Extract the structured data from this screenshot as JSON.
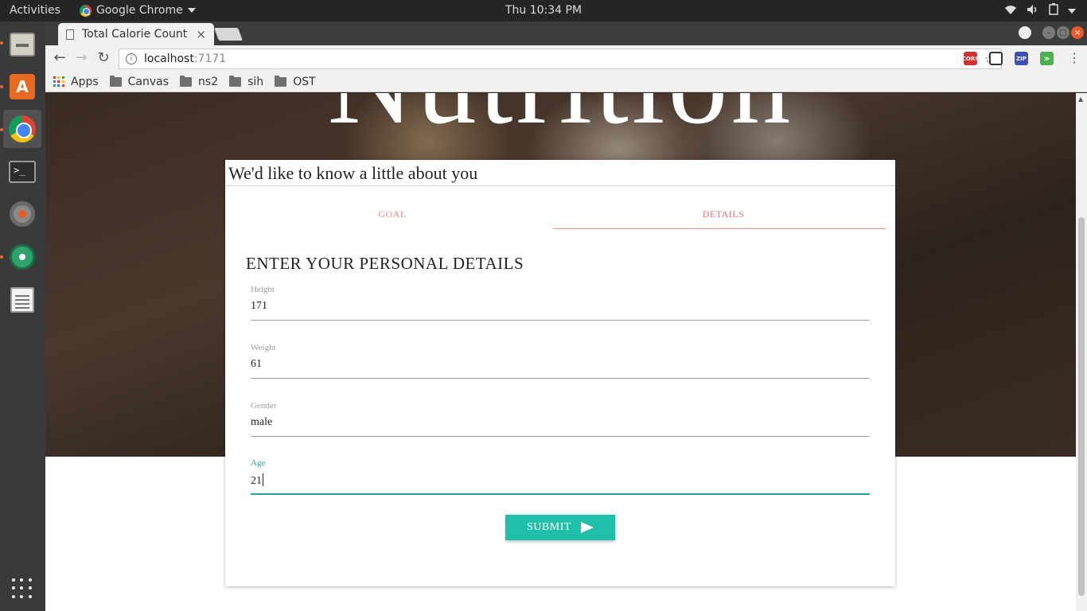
{
  "system": {
    "activities": "Activities",
    "app_name": "Google Chrome",
    "clock": "Thu 10:34 PM"
  },
  "launcher": {
    "terminal_glyph": ">_"
  },
  "browser": {
    "tab_title": "Total Calorie Count",
    "tab_close": "×",
    "url_host": "localhost",
    "url_port": ":7171",
    "extensions": [
      "CORS",
      "ZIP"
    ],
    "bookmarks": [
      "Apps",
      "Canvas",
      "ns2",
      "sih",
      "OST"
    ]
  },
  "page": {
    "hero_title": "Nutrition",
    "card_title": "We'd like to know a little about you",
    "tabs": [
      "GOAL",
      "DETAILS"
    ],
    "active_tab": "DETAILS",
    "section_heading": "ENTER YOUR PERSONAL DETAILS",
    "fields": [
      {
        "label": "Height",
        "value": "171"
      },
      {
        "label": "Weight",
        "value": "61"
      },
      {
        "label": "Gender",
        "value": "male"
      },
      {
        "label": "Age",
        "value": "21"
      }
    ],
    "focused_field": "Age",
    "submit_label": "SUBMIT"
  },
  "colors": {
    "accent_teal": "#1ec0aa",
    "tab_pink": "#f28b82",
    "launcher_bg": "#3a3a3a"
  }
}
